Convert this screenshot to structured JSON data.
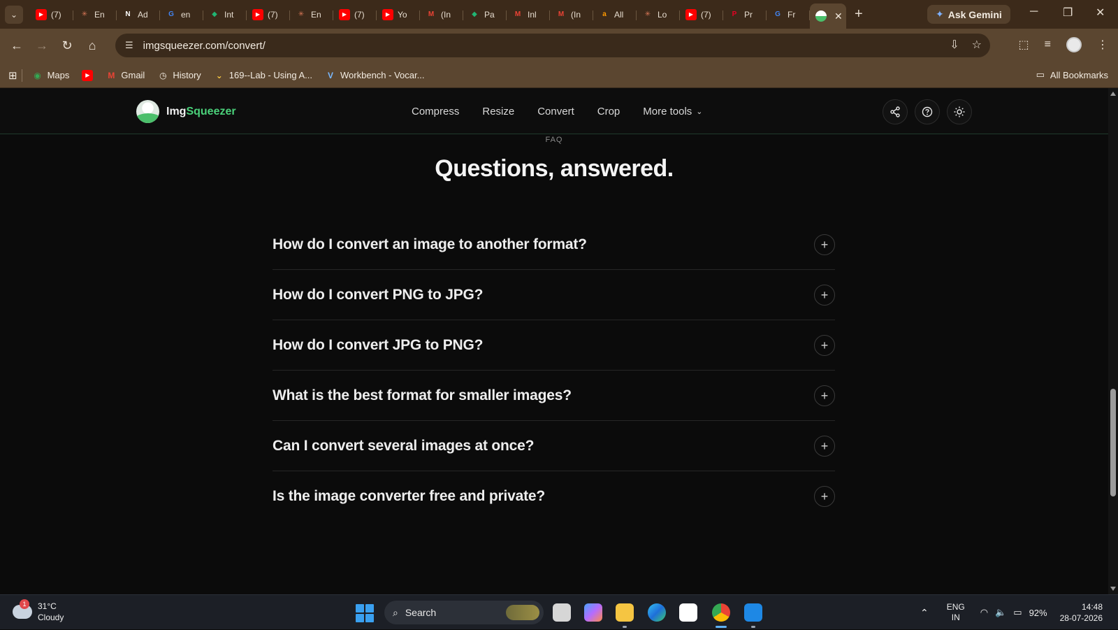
{
  "browser": {
    "tabs": [
      {
        "icon": "youtube-icon",
        "title": "(7)",
        "color": "#ff0000"
      },
      {
        "icon": "claude-icon",
        "title": "En",
        "color": "#d97757"
      },
      {
        "icon": "notion-icon",
        "title": "Ad",
        "color": "#ffffff"
      },
      {
        "icon": "google-icon",
        "title": "en",
        "color": "#4285f4"
      },
      {
        "icon": "shield-icon",
        "title": "Int",
        "color": "#21b573"
      },
      {
        "icon": "youtube-icon",
        "title": "(7)",
        "color": "#ff0000"
      },
      {
        "icon": "claude-icon",
        "title": "En",
        "color": "#d97757"
      },
      {
        "icon": "youtube-icon",
        "title": "(7)",
        "color": "#ff0000"
      },
      {
        "icon": "youtube-icon",
        "title": "Yo",
        "color": "#ff0000"
      },
      {
        "icon": "gmail-icon",
        "title": "(In",
        "color": "#ea4335"
      },
      {
        "icon": "shield-icon",
        "title": "Pa",
        "color": "#21b573"
      },
      {
        "icon": "gmail-icon",
        "title": "Inl",
        "color": "#ea4335"
      },
      {
        "icon": "gmail-icon",
        "title": "(In",
        "color": "#ea4335"
      },
      {
        "icon": "amazon-icon",
        "title": "All",
        "color": "#ff9900"
      },
      {
        "icon": "claude-icon",
        "title": "Lo",
        "color": "#d97757"
      },
      {
        "icon": "youtube-icon",
        "title": "(7)",
        "color": "#ff0000"
      },
      {
        "icon": "pinterest-icon",
        "title": "Pr",
        "color": "#e60023"
      },
      {
        "icon": "google-icon",
        "title": "Fr",
        "color": "#4285f4"
      }
    ],
    "ask_gemini": "Ask Gemini",
    "url": "imgsqueezer.com/convert/",
    "bookmarks": [
      {
        "icon": "maps-icon",
        "label": "Maps"
      },
      {
        "icon": "youtube-icon",
        "label": ""
      },
      {
        "icon": "gmail-icon",
        "label": "Gmail"
      },
      {
        "icon": "history-icon",
        "label": "History"
      },
      {
        "icon": "bookmark-icon",
        "label": "169--Lab - Using A..."
      },
      {
        "icon": "vocareum-icon",
        "label": "Workbench - Vocar..."
      }
    ],
    "all_bookmarks": "All Bookmarks"
  },
  "site": {
    "logo_prefix": "Img",
    "logo_suffix": "Squeezer",
    "nav": [
      "Compress",
      "Resize",
      "Convert",
      "Crop"
    ],
    "more_tools": "More tools",
    "accent": "#4ad17a"
  },
  "faq": {
    "eyebrow": "FAQ",
    "title": "Questions, answered.",
    "items": [
      "How do I convert an image to another format?",
      "How do I convert PNG to JPG?",
      "How do I convert JPG to PNG?",
      "What is the best format for smaller images?",
      "Can I convert several images at once?",
      "Is the image converter free and private?"
    ]
  },
  "taskbar": {
    "weather_badge": "1",
    "temperature": "31°C",
    "condition": "Cloudy",
    "search_placeholder": "Search",
    "lang_top": "ENG",
    "lang_bottom": "IN",
    "battery": "92%",
    "time": "14:48",
    "date": "28-07-2026"
  }
}
